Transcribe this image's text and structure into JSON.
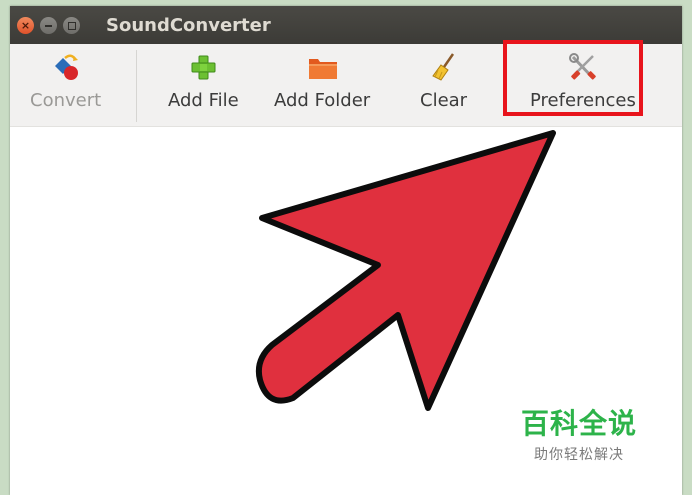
{
  "window": {
    "title": "SoundConverter",
    "controls": [
      "close-icon",
      "minimize-icon",
      "maximize-icon"
    ]
  },
  "toolbar": {
    "convert_label": "Convert",
    "add_file_label": "Add File",
    "add_folder_label": "Add Folder",
    "clear_label": "Clear",
    "preferences_label": "Preferences",
    "icons": {
      "convert": "convert-icon",
      "add_file": "green-plus-icon",
      "add_folder": "folder-icon",
      "clear": "broom-icon",
      "preferences": "tools-icon"
    }
  },
  "annotation": {
    "arrow_color": "#e0303e",
    "highlight_color": "#e8141c"
  },
  "watermark": {
    "title": "百科全说",
    "subtitle": "助你轻松解决",
    "color": "#2db34a"
  }
}
